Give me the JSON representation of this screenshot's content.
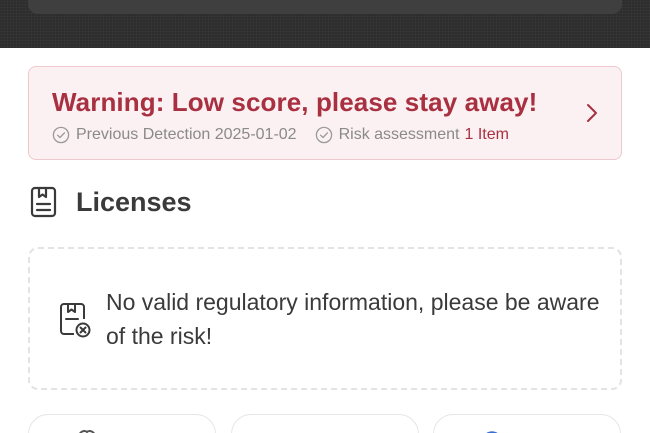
{
  "warning": {
    "title": "Warning: Low score, please stay away!",
    "detection_label": "Previous Detection 2025-01-02",
    "risk_label": "Risk assessment",
    "risk_count": "1 Item"
  },
  "licenses": {
    "title": "Licenses",
    "empty_message": "No valid regulatory information, please be aware of the risk!"
  },
  "colors": {
    "warning_red": "#a93040",
    "warning_bg": "#fbf1f2",
    "header_bg": "#2d2d2d"
  },
  "icons": {
    "detection": "check-circle-icon",
    "risk": "check-circle-icon",
    "warning_link": "chevron-right-icon",
    "licenses": "document-icon",
    "empty": "document-x-icon"
  }
}
